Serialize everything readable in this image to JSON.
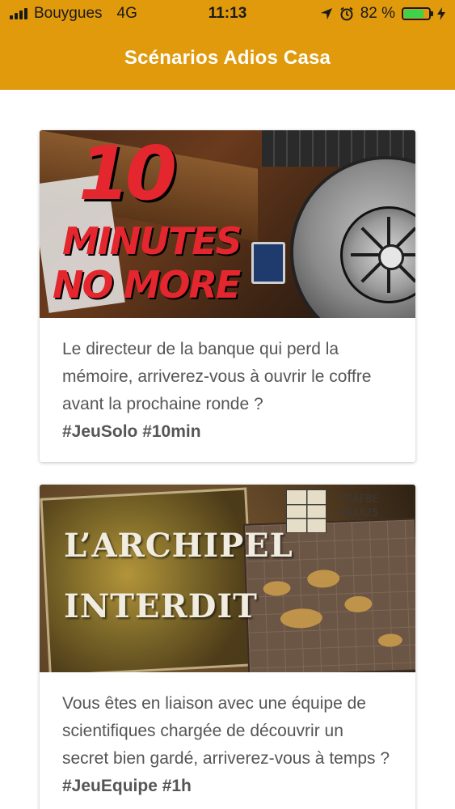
{
  "status_bar": {
    "carrier": "Bouygues",
    "network": "4G",
    "time": "11:13",
    "battery_percent": "82 %",
    "battery_level": 0.82,
    "icons": [
      "signal-bars-icon",
      "location-arrow-icon",
      "alarm-icon",
      "battery-icon",
      "charging-bolt-icon"
    ],
    "colors": {
      "battery_fill": "#3ed24a"
    }
  },
  "header": {
    "title": "Scénarios Adios Casa",
    "color": "#e09a0b"
  },
  "scenarios": [
    {
      "image": {
        "title_number": "10",
        "title_line2": "MINUTES",
        "title_line3": "NO MORE",
        "accent_color": "#e4262e"
      },
      "description": "Le directeur de la banque qui perd la mémoire, arriverez-vous à ouvrir le coffre avant la prochaine ronde ?",
      "tags": "#JeuSolo #10min"
    },
    {
      "image": {
        "title_line1": "L’ARCHIPEL",
        "title_line2": "INTERDIT",
        "grid_code_letters": "FDAFBE",
        "grid_code_numbers": "641625"
      },
      "description": "Vous êtes en liaison avec une équipe de scientifiques chargée de découvrir un secret bien gardé, arriverez-vous à temps ?",
      "tags": "#JeuEquipe #1h"
    }
  ]
}
